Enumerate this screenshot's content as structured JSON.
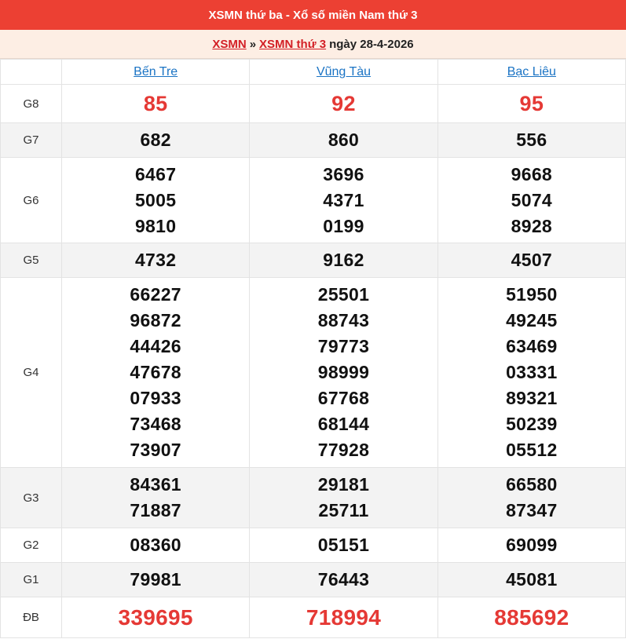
{
  "header": {
    "title": "XSMN thứ ba - Xổ số miền Nam thứ 3"
  },
  "breadcrumb": {
    "link1": "XSMN",
    "sep": "»",
    "link2": "XSMN thứ 3",
    "date": "ngày 28-4-2026"
  },
  "provinces": [
    "Bến Tre",
    "Vũng Tàu",
    "Bạc Liêu"
  ],
  "prizes": [
    {
      "label": "G8",
      "values": [
        [
          "85"
        ],
        [
          "92"
        ],
        [
          "95"
        ]
      ]
    },
    {
      "label": "G7",
      "values": [
        [
          "682"
        ],
        [
          "860"
        ],
        [
          "556"
        ]
      ]
    },
    {
      "label": "G6",
      "values": [
        [
          "6467",
          "5005",
          "9810"
        ],
        [
          "3696",
          "4371",
          "0199"
        ],
        [
          "9668",
          "5074",
          "8928"
        ]
      ]
    },
    {
      "label": "G5",
      "values": [
        [
          "4732"
        ],
        [
          "9162"
        ],
        [
          "4507"
        ]
      ]
    },
    {
      "label": "G4",
      "values": [
        [
          "66227",
          "96872",
          "44426",
          "47678",
          "07933",
          "73468",
          "73907"
        ],
        [
          "25501",
          "88743",
          "79773",
          "98999",
          "67768",
          "68144",
          "77928"
        ],
        [
          "51950",
          "49245",
          "63469",
          "03331",
          "89321",
          "50239",
          "05512"
        ]
      ]
    },
    {
      "label": "G3",
      "values": [
        [
          "84361",
          "71887"
        ],
        [
          "29181",
          "25711"
        ],
        [
          "66580",
          "87347"
        ]
      ]
    },
    {
      "label": "G2",
      "values": [
        [
          "08360"
        ],
        [
          "05151"
        ],
        [
          "69099"
        ]
      ]
    },
    {
      "label": "G1",
      "values": [
        [
          "79981"
        ],
        [
          "76443"
        ],
        [
          "45081"
        ]
      ]
    },
    {
      "label": "ĐB",
      "values": [
        [
          "339695"
        ],
        [
          "718994"
        ],
        [
          "885692"
        ]
      ]
    }
  ]
}
